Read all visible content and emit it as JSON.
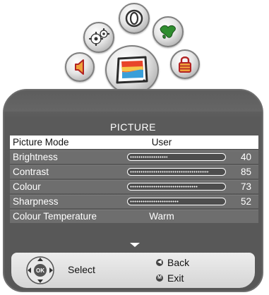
{
  "menu": {
    "title": "PICTURE",
    "rows": [
      {
        "label": "Picture Mode",
        "value": "User",
        "selected": true
      },
      {
        "label": "Brightness",
        "value": 40,
        "level": 0.4
      },
      {
        "label": "Contrast",
        "value": 85,
        "level": 0.85
      },
      {
        "label": "Colour",
        "value": 73,
        "level": 0.73
      },
      {
        "label": "Sharpness",
        "value": 52,
        "level": 0.52
      },
      {
        "label": "Colour Temperature",
        "value": "Warm"
      }
    ]
  },
  "footer": {
    "ok_label": "OK",
    "select_label": "Select",
    "back_label": "Back",
    "exit_label": "Exit",
    "exit_key": "M"
  },
  "icons": [
    "settings-gears-icon",
    "clock-icon",
    "globe-icon",
    "speaker-icon",
    "picture-tv-icon",
    "lock-icon"
  ],
  "colors": {
    "panel": "#5a5a5a",
    "row": "#6e6e6e",
    "selected_row": "#ffffff",
    "footer": "#e0e0e0"
  }
}
